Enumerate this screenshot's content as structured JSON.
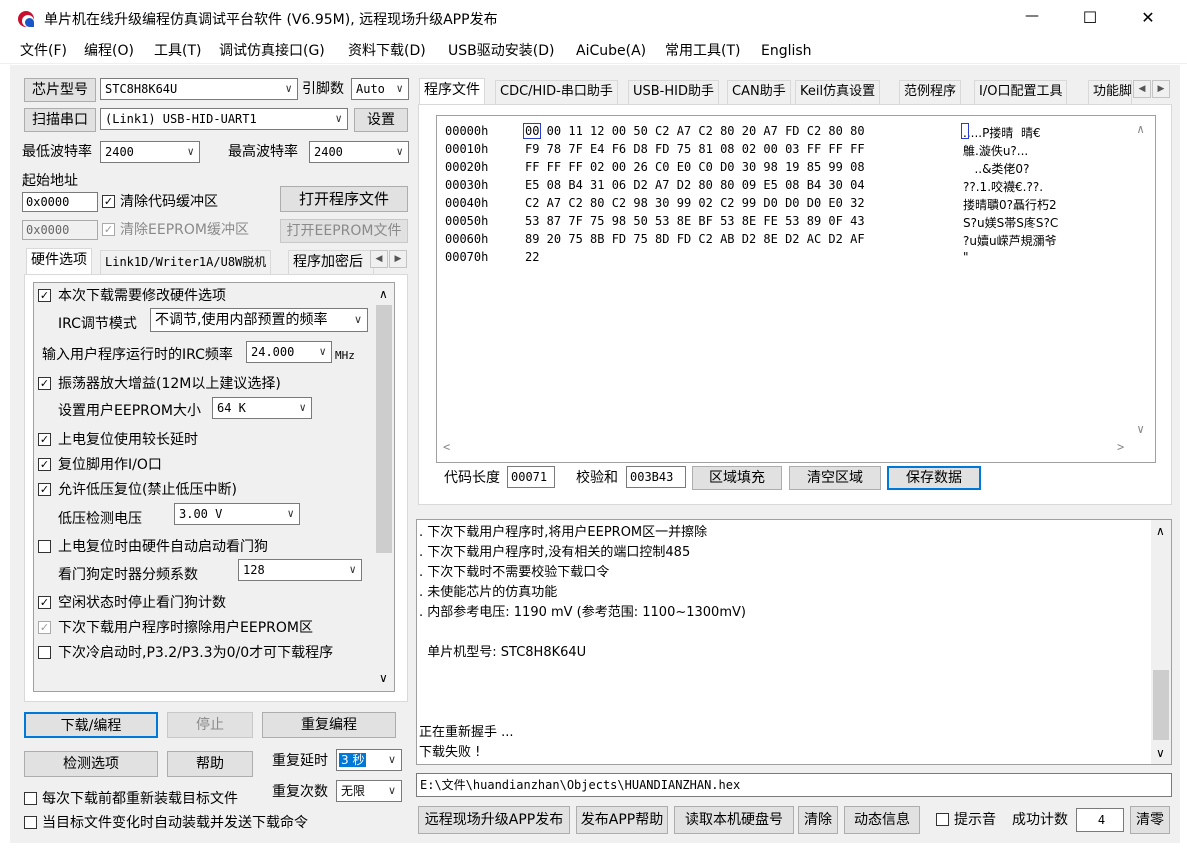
{
  "window": {
    "title": "单片机在线升级编程仿真调试平台软件 (V6.95M), 远程现场升级APP发布",
    "min": "—",
    "max": "☐",
    "close": "✕"
  },
  "menu": [
    "文件(F)",
    "编程(O)",
    "工具(T)",
    "调试仿真接口(G)",
    "资料下载(D)",
    "USB驱动安装(D)",
    "AiCube(A)",
    "常用工具(T)",
    "English"
  ],
  "left": {
    "chip_label": "芯片型号",
    "chip_value": "STC8H8K64U",
    "pin_label": "引脚数",
    "pin_value": "Auto",
    "scan_label": "扫描串口",
    "port_value": "(Link1) USB-HID-UART1",
    "settings_label": "设置",
    "min_baud_label": "最低波特率",
    "min_baud": "2400",
    "max_baud_label": "最高波特率",
    "max_baud": "2400",
    "start_addr_label": "起始地址",
    "code_addr": "0x0000",
    "clear_code_label": "清除代码缓冲区",
    "open_prog_label": "打开程序文件",
    "eeprom_addr": "0x0000",
    "clear_eeprom_label": "清除EEPROM缓冲区",
    "open_eeprom_label": "打开EEPROM文件",
    "tabs": [
      "硬件选项",
      "Link1D/Writer1A/U8W脱机",
      "程序加密后"
    ],
    "options": {
      "modify_hw": "本次下载需要修改硬件选项",
      "irc_mode_label": "IRC调节模式",
      "irc_mode_value": "不调节,使用内部预置的频率",
      "irc_freq_label": "输入用户程序运行时的IRC频率",
      "irc_freq_value": "24.000",
      "irc_freq_unit": "MHz",
      "osc_gain": "振荡器放大增益(12M以上建议选择)",
      "eeprom_size_label": "设置用户EEPROM大小",
      "eeprom_size_value": "64   K",
      "long_delay": "上电复位使用较长延时",
      "reset_io": "复位脚用作I/O口",
      "low_volt_reset": "允许低压复位(禁止低压中断)",
      "low_volt_label": "低压检测电压",
      "low_volt_value": "3.00 V",
      "watchdog": "上电复位时由硬件自动启动看门狗",
      "wdt_div_label": "看门狗定时器分频系数",
      "wdt_div_value": "128",
      "idle_wdt": "空闲状态时停止看门狗计数",
      "erase_eeprom": "下次下载用户程序时擦除用户EEPROM区",
      "cold_boot": "下次冷启动时,P3.2/P3.3为0/0才可下载程序"
    },
    "download_label": "下载/编程",
    "stop_label": "停止",
    "repeat_prog_label": "重复编程",
    "check_label": "检测选项",
    "help_label": "帮助",
    "repeat_delay_label": "重复延时",
    "repeat_delay_value": "3 秒",
    "repeat_count_label": "重复次数",
    "repeat_count_value": "无限",
    "reload_label": "每次下载前都重新装载目标文件",
    "auto_load_label": "当目标文件变化时自动装载并发送下载命令"
  },
  "right": {
    "tabs": [
      "程序文件",
      "CDC/HID-串口助手",
      "USB-HID助手",
      "CAN助手",
      "Keil仿真设置",
      "范例程序",
      "I/O口配置工具",
      "功能脚"
    ],
    "hex_rows": [
      {
        "addr": "00000h",
        "bytes": "00 00 11 12 00 50 C2 A7 C2 80 20 A7 FD C2 80 80",
        "ascii": ".....P搂晴  晴€"
      },
      {
        "addr": "00010h",
        "bytes": "F9 78 7F E4 F6 D8 FD 75 81 08 02 00 03 FF FF FF",
        "ascii": "鵻.漩佚u?..."
      },
      {
        "addr": "00020h",
        "bytes": "FF FF FF 02 00 26 C0 E0 C0 D0 30 98 19 85 99 08",
        "ascii": "   ..&类佬0?"
      },
      {
        "addr": "00030h",
        "bytes": "E5 08 B4 31 06 D2 A7 D2 80 80 09 E5 08 B4 30 04",
        "ascii": "??.1.咬襪€.??."
      },
      {
        "addr": "00040h",
        "bytes": "C2 A7 C2 80 C2 98 30 99 02 C2 99 D0 D0 D0 E0 32",
        "ascii": "搂晴聵0?聶行朽2"
      },
      {
        "addr": "00050h",
        "bytes": "53 87 7F 75 98 50 53 8E BF 53 8E FE 53 89 0F 43",
        "ascii": "S?u媄S帯S庝S?C"
      },
      {
        "addr": "00060h",
        "bytes": "89 20 75 8B FD 75 8D FD C2 AB D2 8E D2 AC D2 AF",
        "ascii": "?u嬻u嵘芦規瀰爷"
      },
      {
        "addr": "00070h",
        "bytes": "22",
        "ascii": "\""
      }
    ],
    "code_len_label": "代码长度",
    "code_len": "00071",
    "checksum_label": "校验和",
    "checksum": "003B43",
    "fill_label": "区域填充",
    "clear_area_label": "清空区域",
    "save_label": "保存数据",
    "log_lines": [
      ". 下次下载用户程序时,将用户EEPROM区一并擦除",
      ". 下次下载用户程序时,没有相关的端口控制485",
      ". 下次下载时不需要校验下载口令",
      ". 未使能芯片的仿真功能",
      ". 内部参考电压: 1190 mV (参考范围: 1100~1300mV)",
      "",
      "  单片机型号: STC8H8K64U",
      "",
      "",
      "",
      "正在重新握手 ...",
      "下载失败 !"
    ],
    "file_path": "E:\\文件\\huandianzhan\\Objects\\HUANDIANZHAN.hex",
    "bottom": {
      "remote_label": "远程现场升级APP发布",
      "app_help_label": "发布APP帮助",
      "disk_label": "读取本机硬盘号",
      "clear_label": "清除",
      "dynamic_label": "动态信息",
      "beep_label": "提示音",
      "success_label": "成功计数",
      "success_count": "4",
      "reset_count_label": "清零"
    }
  }
}
